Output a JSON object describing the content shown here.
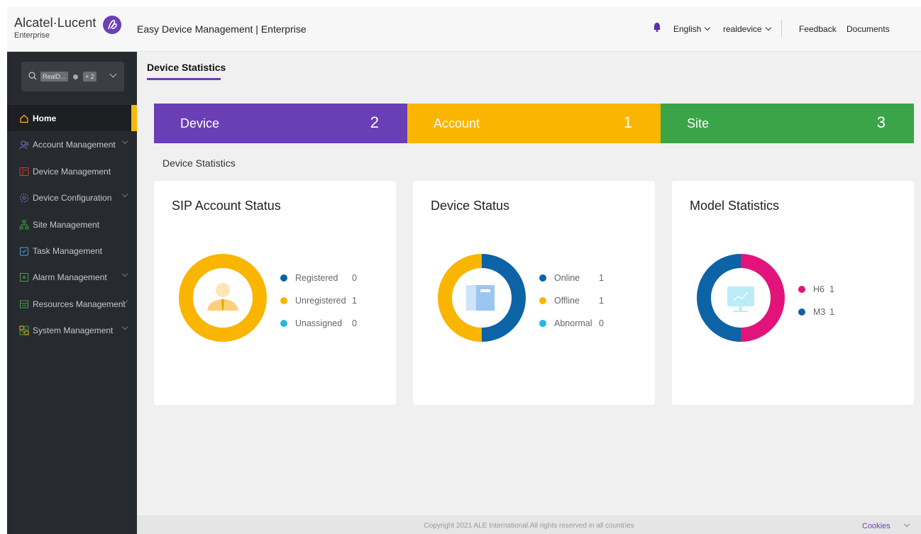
{
  "header": {
    "brand_name": "Alcatel·Lucent",
    "brand_sub": "Enterprise",
    "app_title": "Easy Device Management | Enterprise",
    "language": "English",
    "user": "realdevice",
    "feedback": "Feedback",
    "documents": "Documents"
  },
  "sidebar": {
    "search": {
      "tag1": "RealD...",
      "tag2": "+ 2"
    },
    "items": [
      {
        "label": "Home",
        "icon": "home-icon",
        "expandable": false,
        "active": true
      },
      {
        "label": "Account Management",
        "icon": "users-icon",
        "expandable": true
      },
      {
        "label": "Device Management",
        "icon": "device-icon",
        "expandable": false
      },
      {
        "label": "Device Configuration",
        "icon": "gear-icon",
        "expandable": true
      },
      {
        "label": "Site Management",
        "icon": "sitemap-icon",
        "expandable": false
      },
      {
        "label": "Task Management",
        "icon": "task-icon",
        "expandable": false
      },
      {
        "label": "Alarm Management",
        "icon": "alarm-icon",
        "expandable": true
      },
      {
        "label": "Resources Management",
        "icon": "resources-icon",
        "expandable": true
      },
      {
        "label": "System Management",
        "icon": "system-icon",
        "expandable": true
      }
    ]
  },
  "main": {
    "tab": "Device Statistics",
    "stats": [
      {
        "label": "Device",
        "value": "2",
        "color": "#6a3fb5"
      },
      {
        "label": "Account",
        "value": "1",
        "color": "#f9b500"
      },
      {
        "label": "Site",
        "value": "3",
        "color": "#3aa449"
      }
    ],
    "section_label": "Device Statistics",
    "cards": [
      {
        "title": "SIP Account Status",
        "legend": [
          {
            "name": "Registered",
            "value": "0",
            "color": "#0c63a6"
          },
          {
            "name": "Unregistered",
            "value": "1",
            "color": "#f9b500"
          },
          {
            "name": "Unassigned",
            "value": "0",
            "color": "#25b7e3"
          }
        ]
      },
      {
        "title": "Device Status",
        "legend": [
          {
            "name": "Online",
            "value": "1",
            "color": "#0c63a6"
          },
          {
            "name": "Offline",
            "value": "1",
            "color": "#f9b500"
          },
          {
            "name": "Abnormal",
            "value": "0",
            "color": "#25b7e3"
          }
        ]
      },
      {
        "title": "Model Statistics",
        "legend": [
          {
            "name": "H6",
            "value": "1",
            "color": "#e2147b"
          },
          {
            "name": "M3",
            "value": "1",
            "color": "#0c63a6"
          }
        ]
      }
    ]
  },
  "footer": {
    "copyright": "Copyright 2021 ALE International.All rights reserved in all countries",
    "cookies": "Cookies"
  }
}
